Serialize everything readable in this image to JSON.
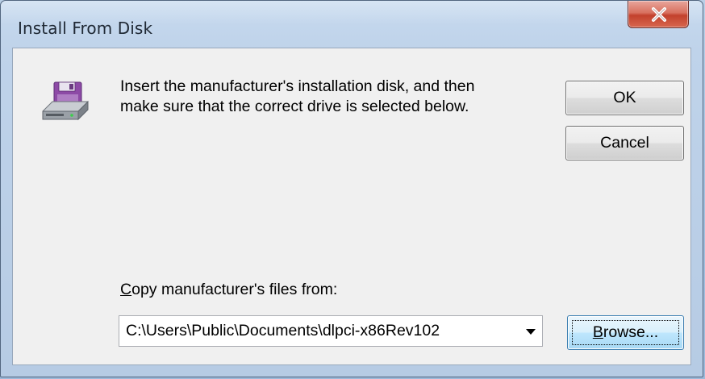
{
  "window": {
    "title": "Install From Disk",
    "close_glyph": "X"
  },
  "dialog": {
    "icon": "floppy-disk-drive-icon",
    "message_line1": "Insert the manufacturer's installation disk, and then",
    "message_line2": "make sure that the correct drive is selected below.",
    "ok_label": "OK",
    "cancel_label": "Cancel",
    "copy_label_accesskey": "C",
    "copy_label_rest": "opy manufacturer's files from:",
    "path_value": "C:\\Users\\Public\\Documents\\dlpci-x86Rev102",
    "browse_accesskey": "B",
    "browse_rest": "rowse..."
  },
  "colors": {
    "accent_close": "#c2412c",
    "client_bg": "#f0f0f0",
    "frame": "#bfd3ea"
  }
}
